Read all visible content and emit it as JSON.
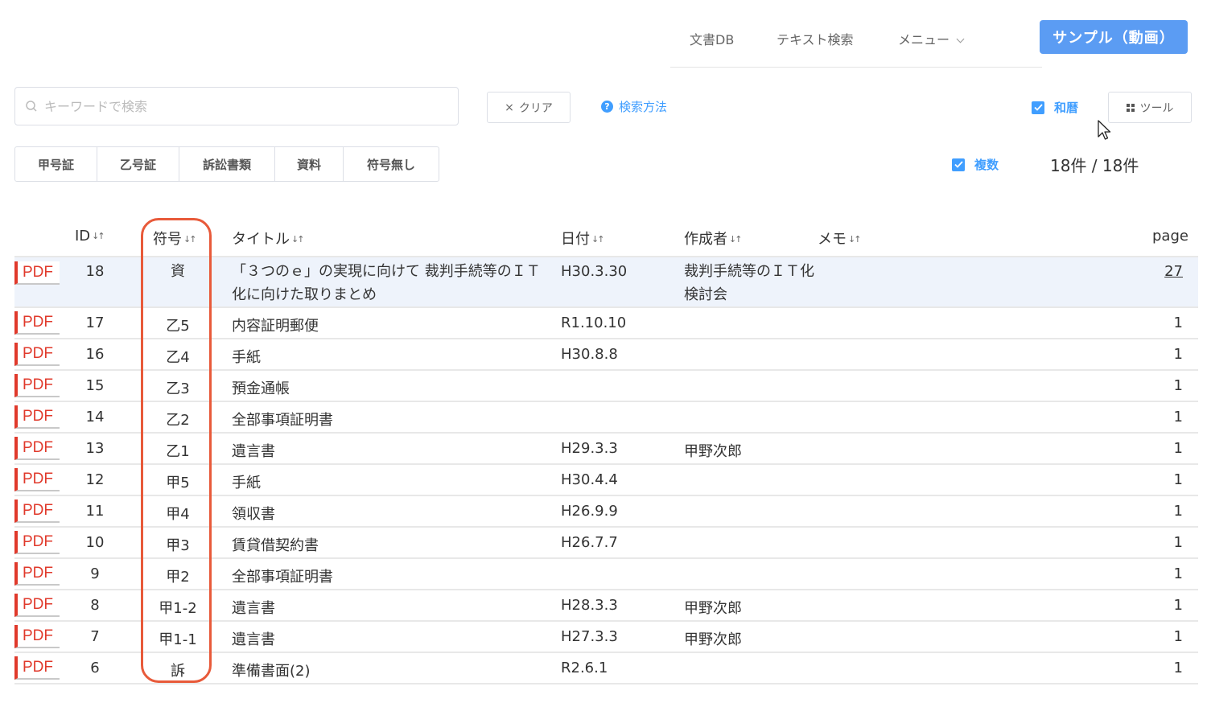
{
  "nav": {
    "docdb": "文書DB",
    "text_search": "テキスト検索",
    "menu": "メニュー",
    "sample_button": "サンプル（動画）"
  },
  "search": {
    "placeholder": "キーワードで検索",
    "clear_label": "クリア",
    "help_label": "検索方法"
  },
  "options": {
    "wareki_label": "和暦",
    "wareki_checked": true,
    "tool_label": "ツール",
    "multi_label": "複数",
    "multi_checked": true,
    "count_text": "18件 / 18件"
  },
  "filters": [
    "甲号証",
    "乙号証",
    "訴訟書類",
    "資料",
    "符号無し"
  ],
  "table": {
    "headers": {
      "id": "ID",
      "sign": "符号",
      "title": "タイトル",
      "date": "日付",
      "author": "作成者",
      "memo": "メモ",
      "page": "page"
    },
    "pdf_label": "PDF",
    "rows": [
      {
        "id": "18",
        "sign": "資",
        "title": "「３つのｅ」の実現に向けて 裁判手続等のＩＴ化に向けた取りまとめ",
        "date": "H30.3.30",
        "author": "裁判手続等のＩＴ化検討会",
        "memo": "",
        "page": "27"
      },
      {
        "id": "17",
        "sign": "乙5",
        "title": "内容証明郵便",
        "date": "R1.10.10",
        "author": "",
        "memo": "",
        "page": "1"
      },
      {
        "id": "16",
        "sign": "乙4",
        "title": "手紙",
        "date": "H30.8.8",
        "author": "",
        "memo": "",
        "page": "1"
      },
      {
        "id": "15",
        "sign": "乙3",
        "title": "預金通帳",
        "date": "",
        "author": "",
        "memo": "",
        "page": "1"
      },
      {
        "id": "14",
        "sign": "乙2",
        "title": "全部事項証明書",
        "date": "",
        "author": "",
        "memo": "",
        "page": "1"
      },
      {
        "id": "13",
        "sign": "乙1",
        "title": "遺言書",
        "date": "H29.3.3",
        "author": "甲野次郎",
        "memo": "",
        "page": "1"
      },
      {
        "id": "12",
        "sign": "甲5",
        "title": "手紙",
        "date": "H30.4.4",
        "author": "",
        "memo": "",
        "page": "1"
      },
      {
        "id": "11",
        "sign": "甲4",
        "title": "領収書",
        "date": "H26.9.9",
        "author": "",
        "memo": "",
        "page": "1"
      },
      {
        "id": "10",
        "sign": "甲3",
        "title": "賃貸借契約書",
        "date": "H26.7.7",
        "author": "",
        "memo": "",
        "page": "1"
      },
      {
        "id": "9",
        "sign": "甲2",
        "title": "全部事項証明書",
        "date": "",
        "author": "",
        "memo": "",
        "page": "1"
      },
      {
        "id": "8",
        "sign": "甲1-2",
        "title": "遺言書",
        "date": "H28.3.3",
        "author": "甲野次郎",
        "memo": "",
        "page": "1"
      },
      {
        "id": "7",
        "sign": "甲1-1",
        "title": "遺言書",
        "date": "H27.3.3",
        "author": "甲野次郎",
        "memo": "",
        "page": "1"
      },
      {
        "id": "6",
        "sign": "訴",
        "title": "準備書面(2)",
        "date": "R2.6.1",
        "author": "",
        "memo": "",
        "page": "1"
      }
    ]
  },
  "colors": {
    "accent": "#409eff",
    "button_blue": "#5b9cf3",
    "pdf_red": "#e0392b",
    "highlight_red": "#e85a3a",
    "selected_row": "#eef3fb"
  }
}
